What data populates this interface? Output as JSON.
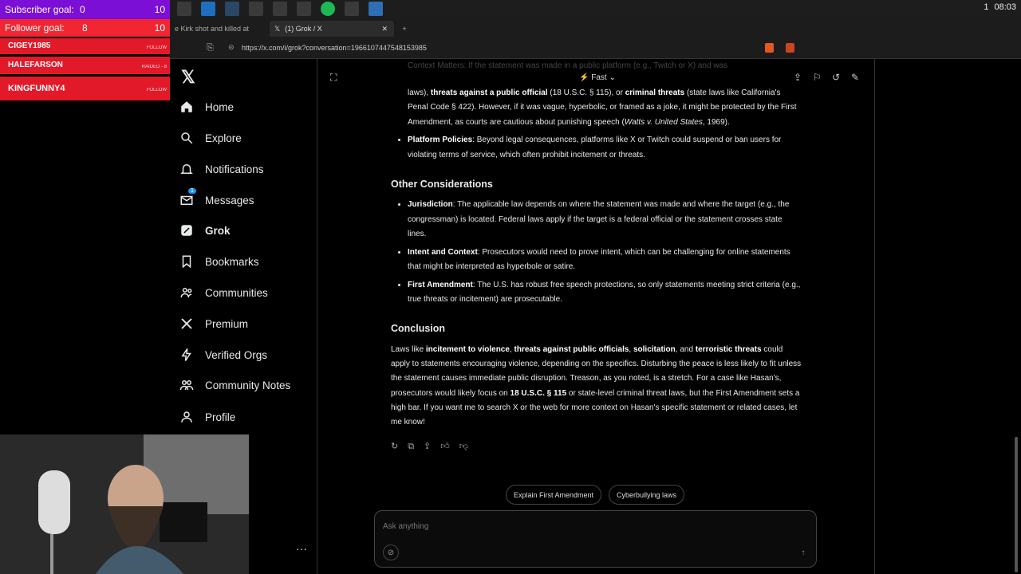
{
  "overlay": {
    "subscriber_goal": "Subscriber goal:",
    "sub_cur": "0",
    "sub_max": "10",
    "follower_goal": "Follower goal:",
    "fol_cur": "8",
    "fol_max": "10",
    "events": [
      {
        "name": "CIGEY1985",
        "tag": "FOLLOW"
      },
      {
        "name": "HALEFARSON",
        "tag": "RAIDED - 8"
      },
      {
        "name": "KINGFUNNY4",
        "tag": "FOLLOW"
      }
    ]
  },
  "system": {
    "clock": "08:03",
    "workspace": "1"
  },
  "browser": {
    "tab_inactive": "e Kirk shot and killed at",
    "tab_active": "(1) Grok / X",
    "url": "https://x.com/i/grok?conversation=1966107447548153985"
  },
  "sidebar": {
    "items": [
      {
        "label": "Home"
      },
      {
        "label": "Explore"
      },
      {
        "label": "Notifications"
      },
      {
        "label": "Messages",
        "badge": "1"
      },
      {
        "label": "Grok"
      },
      {
        "label": "Bookmarks"
      },
      {
        "label": "Communities"
      },
      {
        "label": "Premium"
      },
      {
        "label": "Verified Orgs"
      },
      {
        "label": "Community Notes"
      },
      {
        "label": "Profile"
      }
    ]
  },
  "header": {
    "model": "Fast"
  },
  "content": {
    "partial_top": "Context Matters: If the statement was made in a public platform (e.g., Twitch or X) and was",
    "bullet1_a": "laws), ",
    "bullet1_b": "threats against a public official",
    "bullet1_c": " (18 U.S.C. § 115), or ",
    "bullet1_d": "criminal threats",
    "bullet1_e": " (state laws like California's Penal Code § 422). However, if it was vague, hyperbolic, or framed as a joke, it might be protected by the First Amendment, as courts are cautious about punishing speech (",
    "bullet1_f": "Watts v. United States",
    "bullet1_g": ", 1969).",
    "platform_head": "Platform Policies",
    "platform_text": ": Beyond legal consequences, platforms like X or Twitch could suspend or ban users for violating terms of service, which often prohibit incitement or threats.",
    "other_heading": "Other Considerations",
    "juris_head": "Jurisdiction",
    "juris_text": ": The applicable law depends on where the statement was made and where the target (e.g., the congressman) is located. Federal laws apply if the target is a federal official or the statement crosses state lines.",
    "intent_head": "Intent and Context",
    "intent_text": ": Prosecutors would need to prove intent, which can be challenging for online statements that might be interpreted as hyperbole or satire.",
    "first_head": "First Amendment",
    "first_text": ": The U.S. has robust free speech protections, so only statements meeting strict criteria (e.g., true threats or incitement) are prosecutable.",
    "conclusion_heading": "Conclusion",
    "c1": "Laws like ",
    "c2": "incitement to violence",
    "c3": ", ",
    "c4": "threats against public officials",
    "c5": ", ",
    "c6": "solicitation",
    "c7": ", and ",
    "c8": "terroristic threats",
    "c9": " could apply to statements encouraging violence, depending on the specifics. Disturbing the peace is less likely to fit unless the statement causes immediate public disruption. Treason, as you noted, is a stretch. For a case like Hasan's, prosecutors would likely focus on ",
    "c10": "18 U.S.C. § 115",
    "c11": " or state-level criminal threat laws, but the First Amendment sets a high bar. If you want me to search X or the web for more context on Hasan's specific statement or related cases, let me know!"
  },
  "suggestions": [
    "Explain First Amendment",
    "Cyberbullying laws"
  ],
  "composer": {
    "placeholder": "Ask anything"
  }
}
